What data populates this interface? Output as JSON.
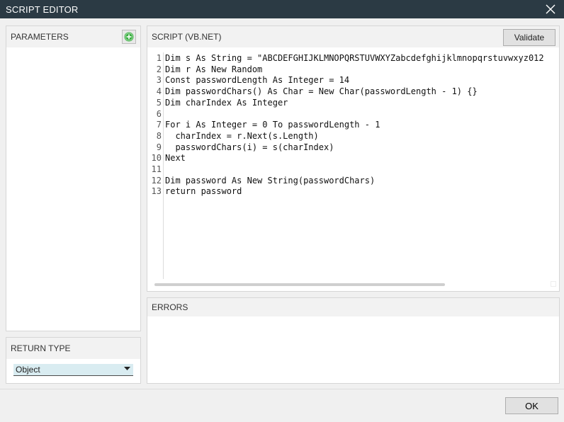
{
  "window": {
    "title": "SCRIPT EDITOR"
  },
  "parameters": {
    "header": "PARAMETERS",
    "add_icon": "plus-circle-icon"
  },
  "return_type": {
    "header": "RETURN TYPE",
    "selected": "Object"
  },
  "script": {
    "header": "SCRIPT (VB.NET)",
    "validate_label": "Validate",
    "lines": [
      {
        "n": "1",
        "text": "Dim s As String = \"ABCDEFGHIJKLMNOPQRSTUVWXYZabcdefghijklmnopqrstuvwxyz012"
      },
      {
        "n": "2",
        "text": "Dim r As New Random"
      },
      {
        "n": "3",
        "text": "Const passwordLength As Integer = 14"
      },
      {
        "n": "4",
        "text": "Dim passwordChars() As Char = New Char(passwordLength - 1) {}"
      },
      {
        "n": "5",
        "text": "Dim charIndex As Integer"
      },
      {
        "n": "6",
        "text": ""
      },
      {
        "n": "7",
        "text": "For i As Integer = 0 To passwordLength - 1"
      },
      {
        "n": "8",
        "text": "  charIndex = r.Next(s.Length)"
      },
      {
        "n": "9",
        "text": "  passwordChars(i) = s(charIndex)"
      },
      {
        "n": "10",
        "text": "Next"
      },
      {
        "n": "11",
        "text": ""
      },
      {
        "n": "12",
        "text": "Dim password As New String(passwordChars)"
      },
      {
        "n": "13",
        "text": "return password"
      }
    ]
  },
  "errors": {
    "header": "ERRORS"
  },
  "footer": {
    "ok_label": "OK"
  },
  "colors": {
    "titlebar": "#2b3a44",
    "add_icon": "#3cb043",
    "select_bg": "#d9ecf1"
  }
}
